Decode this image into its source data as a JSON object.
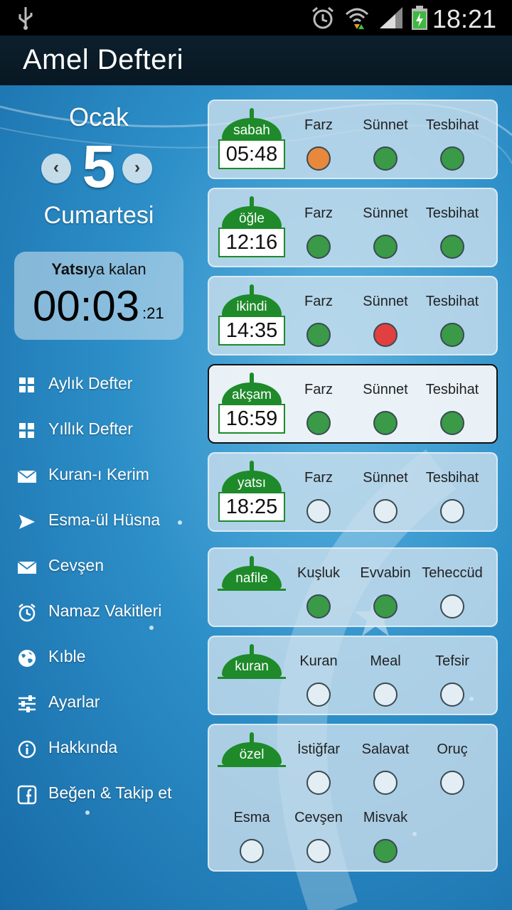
{
  "status": {
    "time": "18:21"
  },
  "app": {
    "title": "Amel Defteri"
  },
  "date": {
    "month": "Ocak",
    "day": "5",
    "weekday": "Cumartesi"
  },
  "countdown": {
    "prayer": "Yatsı",
    "suffix": "ya kalan",
    "main": "00:03",
    "seconds": ":21"
  },
  "menu": [
    {
      "label": "Aylık Defter",
      "icon": "grid-icon"
    },
    {
      "label": "Yıllık Defter",
      "icon": "grid-icon"
    },
    {
      "label": "Kuran-ı Kerim",
      "icon": "envelope-icon"
    },
    {
      "label": "Esma-ül Hüsna",
      "icon": "send-icon"
    },
    {
      "label": "Cevşen",
      "icon": "envelope-icon"
    },
    {
      "label": "Namaz Vakitleri",
      "icon": "alarm-icon"
    },
    {
      "label": "Kıble",
      "icon": "globe-icon"
    },
    {
      "label": "Ayarlar",
      "icon": "sliders-icon"
    },
    {
      "label": "Hakkında",
      "icon": "info-icon"
    },
    {
      "label": "Beğen & Takip et",
      "icon": "facebook-icon"
    }
  ],
  "prayers": [
    {
      "name": "sabah",
      "time": "05:48",
      "cols": [
        {
          "label": "Farz",
          "state": "orange"
        },
        {
          "label": "Sünnet",
          "state": "green"
        },
        {
          "label": "Tesbihat",
          "state": "green"
        }
      ]
    },
    {
      "name": "öğle",
      "time": "12:16",
      "cols": [
        {
          "label": "Farz",
          "state": "green"
        },
        {
          "label": "Sünnet",
          "state": "green"
        },
        {
          "label": "Tesbihat",
          "state": "green"
        }
      ]
    },
    {
      "name": "ikindi",
      "time": "14:35",
      "cols": [
        {
          "label": "Farz",
          "state": "green"
        },
        {
          "label": "Sünnet",
          "state": "red"
        },
        {
          "label": "Tesbihat",
          "state": "green"
        }
      ]
    },
    {
      "name": "akşam",
      "time": "16:59",
      "cols": [
        {
          "label": "Farz",
          "state": "green"
        },
        {
          "label": "Sünnet",
          "state": "green"
        },
        {
          "label": "Tesbihat",
          "state": "green"
        }
      ]
    },
    {
      "name": "yatsı",
      "time": "18:25",
      "cols": [
        {
          "label": "Farz",
          "state": "empty"
        },
        {
          "label": "Sünnet",
          "state": "empty"
        },
        {
          "label": "Tesbihat",
          "state": "empty"
        }
      ]
    }
  ],
  "extras": [
    {
      "name": "nafile",
      "cols": [
        {
          "label": "Kuşluk",
          "state": "green"
        },
        {
          "label": "Evvabin",
          "state": "green"
        },
        {
          "label": "Teheccüd",
          "state": "empty"
        }
      ]
    },
    {
      "name": "kuran",
      "cols": [
        {
          "label": "Kuran",
          "state": "empty"
        },
        {
          "label": "Meal",
          "state": "empty"
        },
        {
          "label": "Tefsir",
          "state": "empty"
        }
      ]
    }
  ],
  "ozel": {
    "name": "özel",
    "row1": [
      {
        "label": "İstiğfar",
        "state": "empty"
      },
      {
        "label": "Salavat",
        "state": "empty"
      },
      {
        "label": "Oruç",
        "state": "empty"
      }
    ],
    "row2": [
      {
        "label": "Esma",
        "state": "empty"
      },
      {
        "label": "Cevşen",
        "state": "empty"
      },
      {
        "label": "Misvak",
        "state": "green"
      }
    ]
  },
  "colors": {
    "green": "#3a9a47",
    "orange": "#e8883c",
    "red": "#e04040",
    "empty": "#e2edf4",
    "accent": "#1e8a2a"
  }
}
